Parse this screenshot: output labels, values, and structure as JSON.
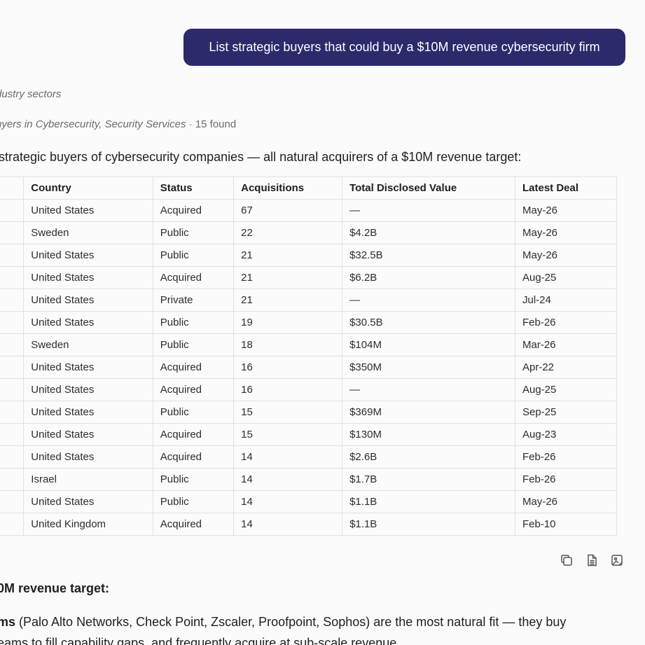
{
  "user_message": "List strategic buyers that could buy a $10M revenue cybersecurity firm",
  "tool_lines": {
    "line1": "dustry sectors",
    "line2_italic": "uyers in Cybersecurity, Security Services",
    "line2_count": " · 15 found"
  },
  "intro": " strategic buyers of cybersecurity companies — all natural acquirers of a $10M revenue target:",
  "table": {
    "headers": [
      "Country",
      "Status",
      "Acquisitions",
      "Total Disclosed Value",
      "Latest Deal"
    ],
    "rows": [
      [
        "United States",
        "Acquired",
        "67",
        "—",
        "May-26"
      ],
      [
        "Sweden",
        "Public",
        "22",
        "$4.2B",
        "May-26"
      ],
      [
        "United States",
        "Public",
        "21",
        "$32.5B",
        "May-26"
      ],
      [
        "United States",
        "Acquired",
        "21",
        "$6.2B",
        "Aug-25"
      ],
      [
        "United States",
        "Private",
        "21",
        "—",
        "Jul-24"
      ],
      [
        "United States",
        "Public",
        "19",
        "$30.5B",
        "Feb-26"
      ],
      [
        "Sweden",
        "Public",
        "18",
        "$104M",
        "Mar-26"
      ],
      [
        "United States",
        "Acquired",
        "16",
        "$350M",
        "Apr-22"
      ],
      [
        "United States",
        "Acquired",
        "16",
        "—",
        "Aug-25"
      ],
      [
        "United States",
        "Public",
        "15",
        "$369M",
        "Sep-25"
      ],
      [
        "United States",
        "Acquired",
        "15",
        "$130M",
        "Aug-23"
      ],
      [
        "United States",
        "Acquired",
        "14",
        "$2.6B",
        "Feb-26"
      ],
      [
        "Israel",
        "Public",
        "14",
        "$1.7B",
        "Feb-26"
      ],
      [
        "United States",
        "Public",
        "14",
        "$1.1B",
        "May-26"
      ],
      [
        "United Kingdom",
        "Acquired",
        "14",
        "$1.1B",
        "Feb-10"
      ]
    ]
  },
  "actions": {
    "icons": [
      "copy-icon",
      "document-icon",
      "image-icon"
    ]
  },
  "section_heading": "0M revenue target:",
  "paragraph": {
    "bold_start": "ms",
    "line1_rest": " (Palo Alto Networks, Check Point, Zscaler, Proofpoint, Sophos) are the most natural fit — they buy",
    "line2": "eams to fill capability gaps, and frequently acquire at sub-scale revenue."
  }
}
